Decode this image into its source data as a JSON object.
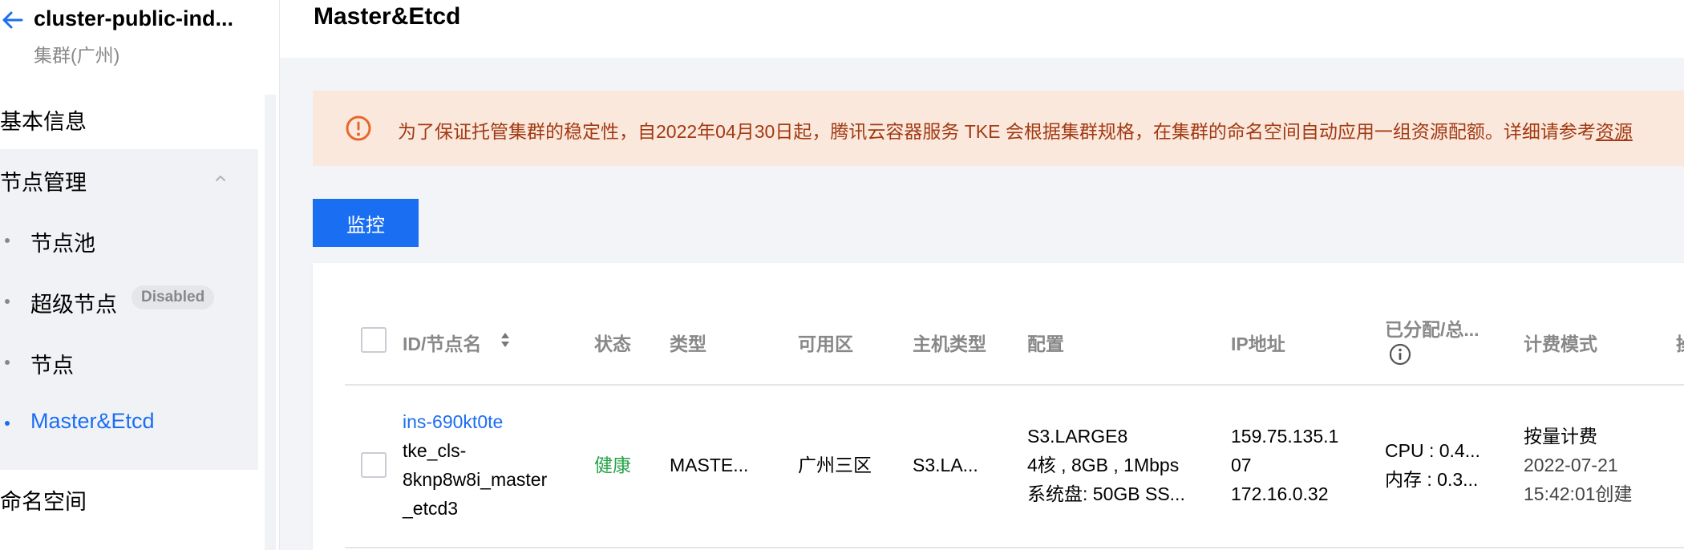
{
  "sidebar": {
    "cluster_name": "cluster-public-ind...",
    "cluster_region": "集群(广州)",
    "menu": {
      "basic_info": "基本信息",
      "node_management": "节点管理",
      "namespace": "命名空间"
    },
    "sub_items": [
      {
        "label": "节点池"
      },
      {
        "label": "超级节点",
        "badge": "Disabled"
      },
      {
        "label": "节点"
      },
      {
        "label": "Master&Etcd",
        "active": true
      }
    ]
  },
  "page": {
    "title": "Master&Etcd"
  },
  "notice": {
    "text": "为了保证托管集群的稳定性，自2022年04月30日起，腾讯云容器服务 TKE 会根据集群规格，在集群的命名空间自动应用一组资源配额。详细请参考",
    "link": "资源"
  },
  "toolbar": {
    "monitor_label": "监控"
  },
  "table": {
    "columns": [
      "ID/节点名",
      "状态",
      "类型",
      "可用区",
      "主机类型",
      "配置",
      "IP地址",
      "已分配/总...",
      "计费模式",
      "操"
    ],
    "rows": [
      {
        "id": "ins-690kt0te",
        "name_lines": [
          "tke_cls-",
          "8knp8w8i_master",
          "_etcd3"
        ],
        "status": "健康",
        "type": "MASTE...",
        "zone": "广州三区",
        "host_type": "S3.LA...",
        "config_lines": [
          "S3.LARGE8",
          "4核 , 8GB , 1Mbps",
          "系统盘: 50GB SS..."
        ],
        "ip_lines": [
          "159.75.135.1",
          "07",
          "172.16.0.32"
        ],
        "alloc_lines": [
          "CPU : 0.4...",
          "内存 : 0.3..."
        ],
        "billing_lines": [
          "按量计费",
          "2022-07-21",
          "15:42:01创建"
        ]
      }
    ]
  },
  "colors": {
    "primary": "#1a6ef2",
    "notice_bg": "#fbe8dc",
    "notice_text": "#a23a13",
    "healthy": "#29a34a"
  }
}
